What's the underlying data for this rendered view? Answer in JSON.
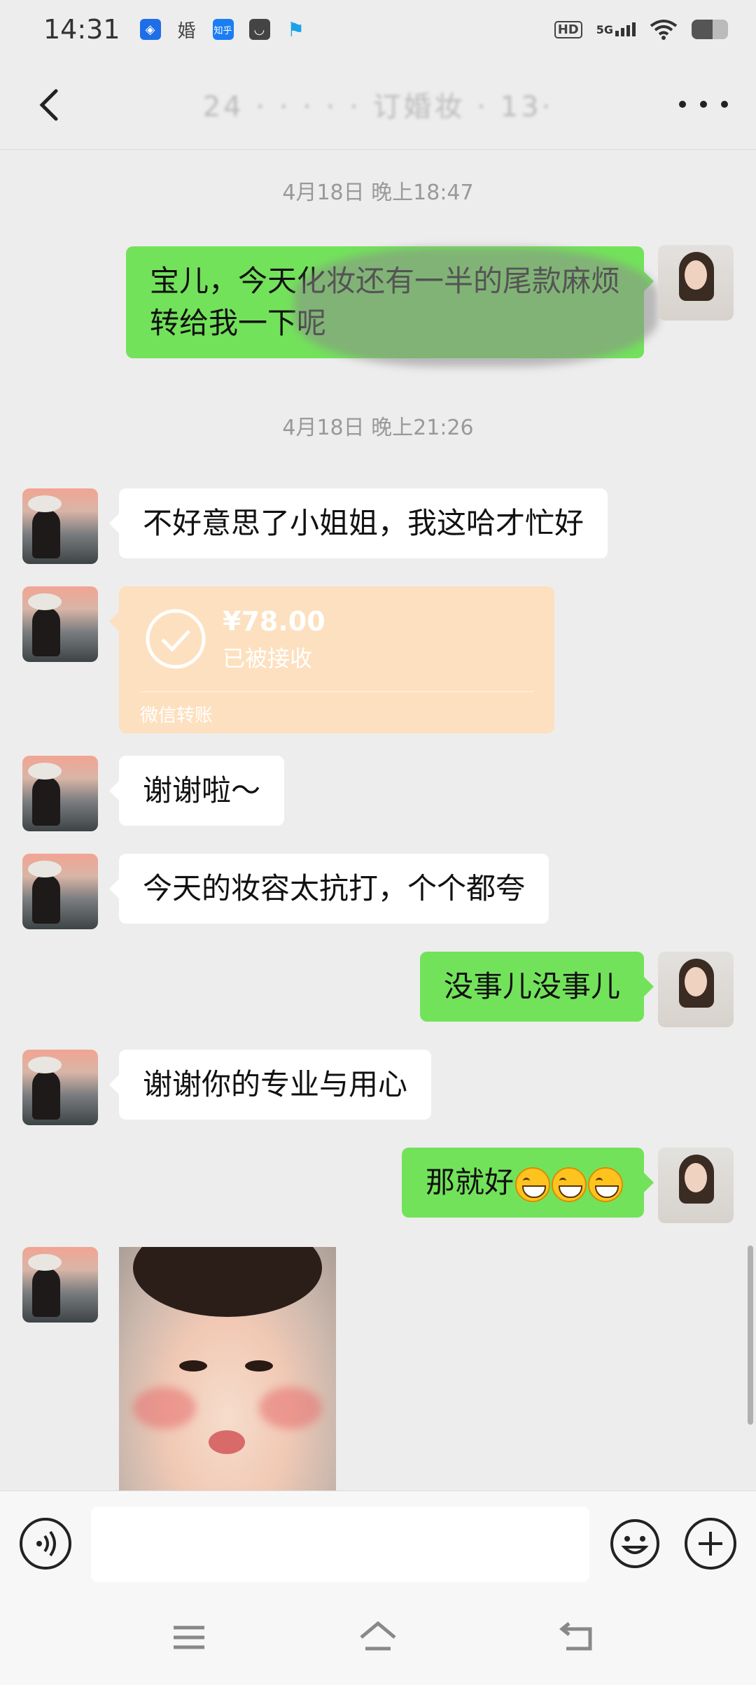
{
  "status_bar": {
    "time": "14:31",
    "apps": [
      "cube-app-icon",
      "marriage-app-icon",
      "zhihu-app-icon",
      "shop-app-icon",
      "flag-app-icon"
    ],
    "app_glyphs": [
      "◈",
      "婚",
      "知乎",
      "◡",
      "⚑"
    ],
    "network": "5G",
    "hd": "HD"
  },
  "header": {
    "title": "24 · · · · · 订婚妆 · 13·",
    "back_icon": "chevron-left-icon",
    "more_icon": "more-dots-icon"
  },
  "chat": {
    "timestamps": [
      "4月18日 晚上18:47",
      "4月18日 晚上21:26"
    ],
    "messages": [
      {
        "side": "out",
        "text": "宝儿，今天化妆还有一半的尾款麻烦转给我一下呢"
      },
      {
        "side": "in",
        "text": "不好意思了小姐姐，我这哈才忙好"
      },
      {
        "side": "in",
        "type": "transfer",
        "amount": "¥78.00",
        "status": "已被接收",
        "label": "微信转账"
      },
      {
        "side": "in",
        "text": "谢谢啦～"
      },
      {
        "side": "in",
        "text": "今天的妆容太抗打，个个都夸"
      },
      {
        "side": "out",
        "text": "没事儿没事儿"
      },
      {
        "side": "in",
        "text": "谢谢你的专业与用心"
      },
      {
        "side": "out",
        "text": "那就好",
        "emoji_count": 3
      },
      {
        "side": "in",
        "type": "sticker",
        "icon": "baby-sticker-image"
      }
    ]
  },
  "input_bar": {
    "voice_icon": "voice-icon",
    "input_value": "",
    "emoji_icon": "emoji-icon",
    "plus_icon": "plus-icon"
  },
  "system_nav": {
    "menu_icon": "menu-icon",
    "home_icon": "home-icon",
    "back_icon": "back-icon"
  },
  "colors": {
    "bubble_out": "#73e25b",
    "bubble_in": "#ffffff",
    "transfer": "#fde0bf",
    "background": "#ededed"
  }
}
